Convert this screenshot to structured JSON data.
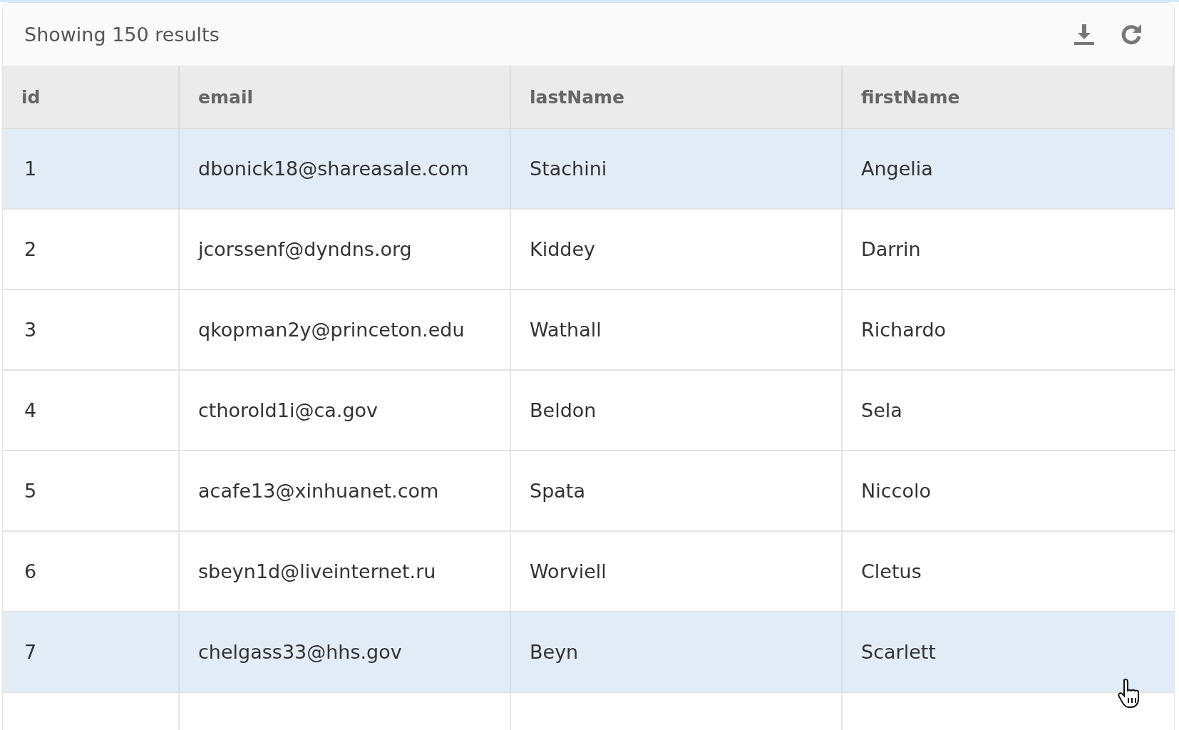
{
  "toolbar": {
    "summary": "Showing 150 results"
  },
  "table": {
    "columns": [
      "id",
      "email",
      "lastName",
      "firstName"
    ],
    "rows": [
      {
        "cells": [
          "1",
          "dbonick18@shareasale.com",
          "Stachini",
          "Angelia"
        ],
        "highlighted": true
      },
      {
        "cells": [
          "2",
          "jcorssenf@dyndns.org",
          "Kiddey",
          "Darrin"
        ],
        "highlighted": false
      },
      {
        "cells": [
          "3",
          "qkopman2y@princeton.edu",
          "Wathall",
          "Richardo"
        ],
        "highlighted": false
      },
      {
        "cells": [
          "4",
          "cthorold1i@ca.gov",
          "Beldon",
          "Sela"
        ],
        "highlighted": false
      },
      {
        "cells": [
          "5",
          "acafe13@xinhuanet.com",
          "Spata",
          "Niccolo"
        ],
        "highlighted": false
      },
      {
        "cells": [
          "6",
          "sbeyn1d@liveinternet.ru",
          "Worviell",
          "Cletus"
        ],
        "highlighted": false
      },
      {
        "cells": [
          "7",
          "chelgass33@hhs.gov",
          "Beyn",
          "Scarlett"
        ],
        "highlighted": true
      }
    ]
  }
}
